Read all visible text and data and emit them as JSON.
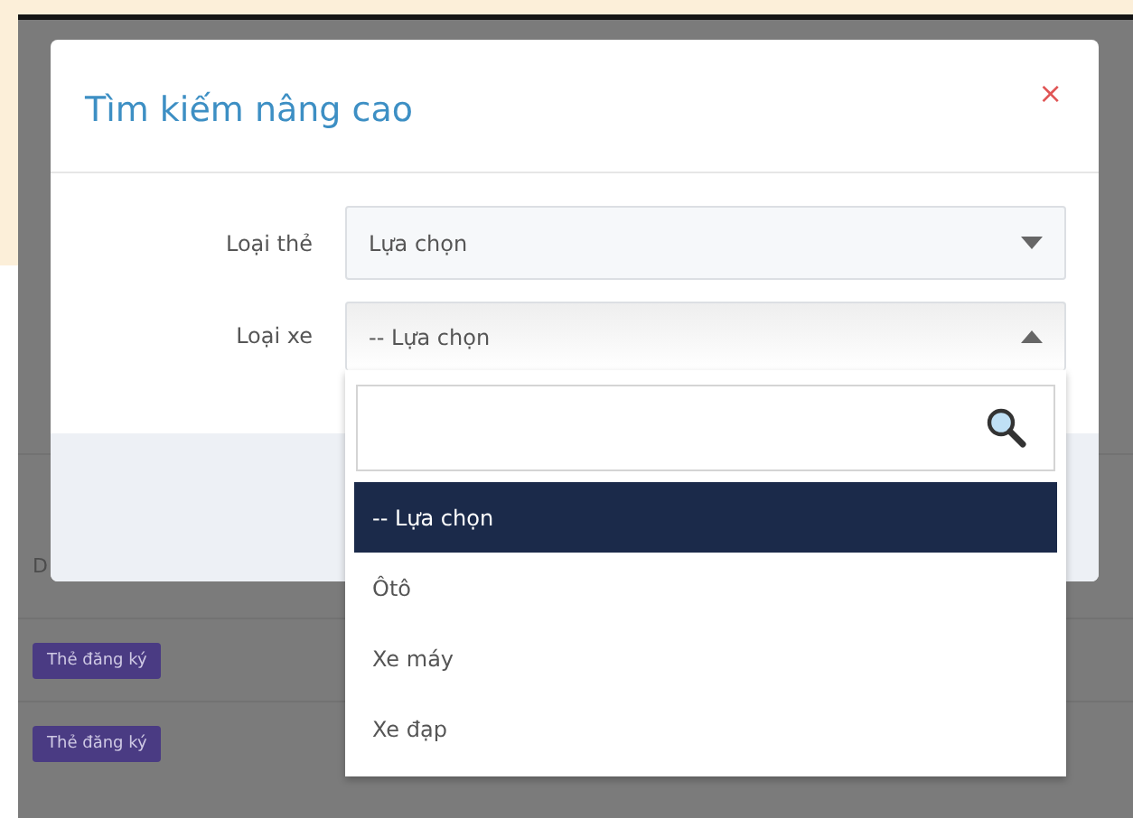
{
  "background": {
    "column_header": "D",
    "rows": [
      {
        "badge": "Thẻ đăng ký"
      },
      {
        "badge": "Thẻ đăng ký"
      }
    ]
  },
  "modal": {
    "title": "Tìm kiếm nâng cao",
    "close": "×",
    "fields": [
      {
        "label": "Loại thẻ",
        "value": "Lựa chọn",
        "expanded": false
      },
      {
        "label": "Loại xe",
        "value": "-- Lựa chọn",
        "expanded": true
      }
    ]
  },
  "dropdown": {
    "options": [
      {
        "label": "-- Lựa chọn",
        "selected": true
      },
      {
        "label": "Ôtô",
        "selected": false
      },
      {
        "label": "Xe máy",
        "selected": false
      },
      {
        "label": "Xe đạp",
        "selected": false
      }
    ]
  }
}
